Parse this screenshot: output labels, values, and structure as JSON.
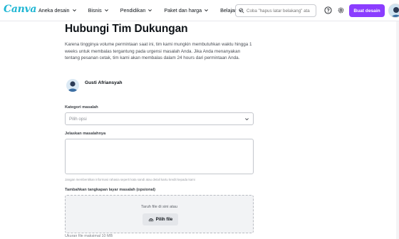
{
  "app": {
    "logo": "Canva"
  },
  "nav": {
    "items": [
      {
        "label": "Aneka desain"
      },
      {
        "label": "Bisnis"
      },
      {
        "label": "Pendidikan"
      },
      {
        "label": "Paket dan harga"
      },
      {
        "label": "Belajar"
      }
    ]
  },
  "search": {
    "placeholder": "Coba \"hapus latar belakang\" ata"
  },
  "header": {
    "create_label": "Buat desain"
  },
  "page": {
    "title": "Hubungi Tim Dukungan",
    "intro": "Karena tingginya volume permintaan saat ini, tim kami mungkin membutuhkan waktu hingga 1 weeks untuk membalas tergantung pada urgensi masalah Anda. Jika Anda menanyakan tentang pesanan cetak, tim kami akan membalas dalam 24 hours dari permintaan Anda.",
    "user_name": "Gusti Afriansyah"
  },
  "form": {
    "category_label": "Kategori masalah",
    "category_placeholder": "Pilih opsi",
    "describe_label": "Jelaskan masalahnya",
    "privacy_hint": "Jangan membentikan informasi rahasia seperti kata sandi atau detail kartu kredit kepada kami",
    "screenshot_label": "Tambahkan tangkapan layar masalah (opsional)",
    "drop_text": "Taruh file di sini atau",
    "choose_file_label": "Pilih file",
    "max_size": "Ukuran file maksimal 10 MB"
  },
  "colors": {
    "accent": "#8b3dff",
    "logo": "#1fb6d3"
  }
}
